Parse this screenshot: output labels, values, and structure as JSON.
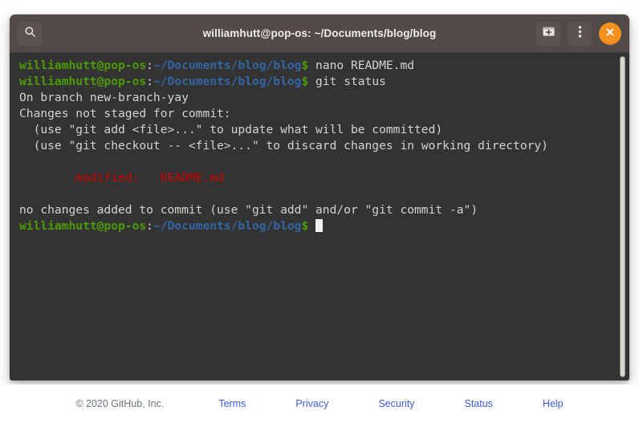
{
  "window": {
    "title": "williamhutt@pop-os: ~/Documents/blog/blog",
    "search_icon": "search-icon",
    "new_terminal_icon": "new-terminal-icon",
    "menu_icon": "kebab-menu-icon",
    "close_icon": "close-icon"
  },
  "colors": {
    "titlebar_bg": "#514a46",
    "terminal_bg": "#333333",
    "prompt_user": "#4e9a06",
    "prompt_path": "#3465a4",
    "modified_red": "#cc0000",
    "close_button": "#f5921e",
    "footer_link": "#3b5bdb",
    "footer_text": "#6a737d"
  },
  "terminal": {
    "prompt": {
      "user": "williamhutt@pop-os",
      "colon": ":",
      "path": "~/Documents/blog/blog",
      "dollar": "$"
    },
    "lines": [
      {
        "type": "prompt",
        "command": " nano README.md"
      },
      {
        "type": "prompt",
        "command": " git status"
      },
      {
        "type": "plain",
        "text": "On branch new-branch-yay"
      },
      {
        "type": "plain",
        "text": "Changes not staged for commit:"
      },
      {
        "type": "plain",
        "text": "  (use \"git add <file>...\" to update what will be committed)"
      },
      {
        "type": "plain",
        "text": "  (use \"git checkout -- <file>...\" to discard changes in working directory)"
      },
      {
        "type": "plain",
        "text": ""
      },
      {
        "type": "red",
        "text": "\tmodified:   README.md"
      },
      {
        "type": "plain",
        "text": ""
      },
      {
        "type": "plain",
        "text": "no changes added to commit (use \"git add\" and/or \"git commit -a\")"
      },
      {
        "type": "prompt-cursor",
        "command": " "
      }
    ]
  },
  "footer": {
    "copyright": "© 2020 GitHub, Inc.",
    "links": [
      {
        "label": "Terms"
      },
      {
        "label": "Privacy"
      },
      {
        "label": "Security"
      },
      {
        "label": "Status"
      },
      {
        "label": "Help"
      }
    ]
  }
}
